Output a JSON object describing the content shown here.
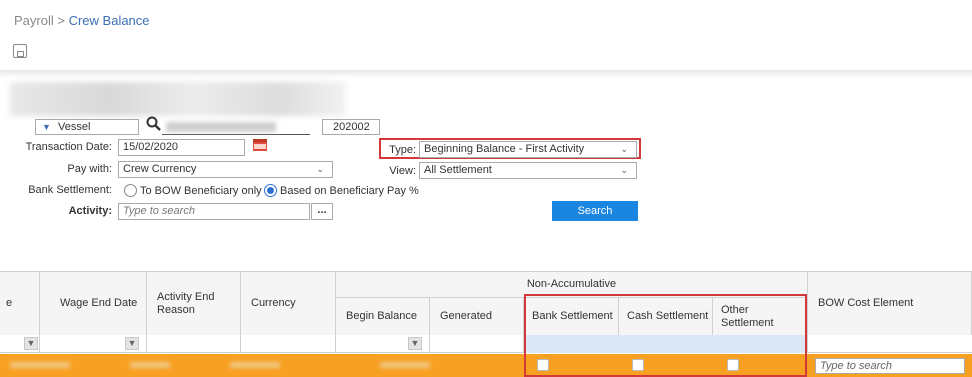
{
  "breadcrumb": {
    "parent": "Payroll",
    "separator": ">",
    "current": "Crew Balance"
  },
  "icons": {
    "save": "save-icon",
    "search": "search-icon",
    "calendar": "calendar-icon",
    "filter": "filter-icon"
  },
  "filters": {
    "vessel_select": "Vessel",
    "vessel_code": "202002",
    "transaction_date_label": "Transaction Date:",
    "transaction_date": "15/02/2020",
    "pay_with_label": "Pay with:",
    "pay_with": "Crew Currency",
    "bank_settlement_label": "Bank Settlement:",
    "bank_option_1": "To BOW Beneficiary only",
    "bank_option_2": "Based on Beneficiary Pay %",
    "bank_selected": "Based on Beneficiary Pay %",
    "activity_label": "Activity:",
    "activity_placeholder": "Type to search",
    "activity_button": "...",
    "type_label": "Type:",
    "type_value": "Beginning Balance - First Activity",
    "view_label": "View:",
    "view_value": "All Settlement",
    "search_button": "Search"
  },
  "grid": {
    "group_header": "Non-Accumulative",
    "columns": {
      "partial": "e",
      "wage_end_date": "Wage End Date",
      "activity_end_reason": "Activity End Reason",
      "currency": "Currency",
      "begin_balance": "Begin Balance",
      "generated": "Generated",
      "bank_settlement": "Bank Settlement",
      "cash_settlement": "Cash Settlement",
      "other_settlement": "Other Settlement",
      "bow_cost_element": "BOW Cost Element"
    },
    "row_bow_placeholder": "Type to search"
  },
  "colors": {
    "accent": "#1a86e0",
    "row_highlight": "#f7a022",
    "annotation": "#d23a3a",
    "link": "#3d6fb5"
  }
}
